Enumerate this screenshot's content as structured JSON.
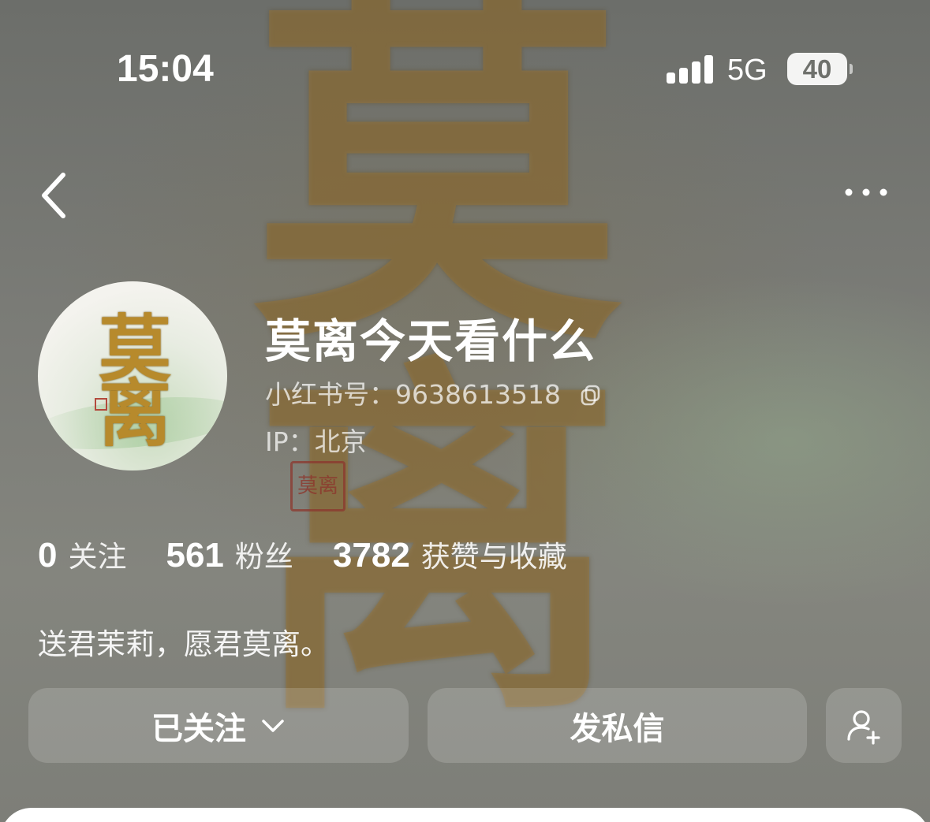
{
  "status_bar": {
    "time": "15:04",
    "network": "5G",
    "battery": "40"
  },
  "nav": {
    "back_icon": "chevron-left-icon",
    "more_icon": "more-horizontal-icon"
  },
  "background": {
    "calligraphy": "莫离",
    "seal": "莫离"
  },
  "profile": {
    "avatar_text": [
      "莫",
      "离"
    ],
    "username": "莫离今天看什么",
    "redbook_id": "小红书号：9638613518",
    "ip": "IP：北京",
    "bio": "送君茉莉，愿君莫离。"
  },
  "stats": [
    {
      "value": "0",
      "label": "关注"
    },
    {
      "value": "561",
      "label": "粉丝"
    },
    {
      "value": "3782",
      "label": "获赞与收藏"
    }
  ],
  "actions": {
    "follow_label": "已关注",
    "message_label": "发私信",
    "add_friend_icon": "add-user-icon"
  },
  "colors": {
    "background": "#7d7f78",
    "button": "rgba(255,255,255,0.16)",
    "calligraphy_gold": "#b78a2c"
  }
}
